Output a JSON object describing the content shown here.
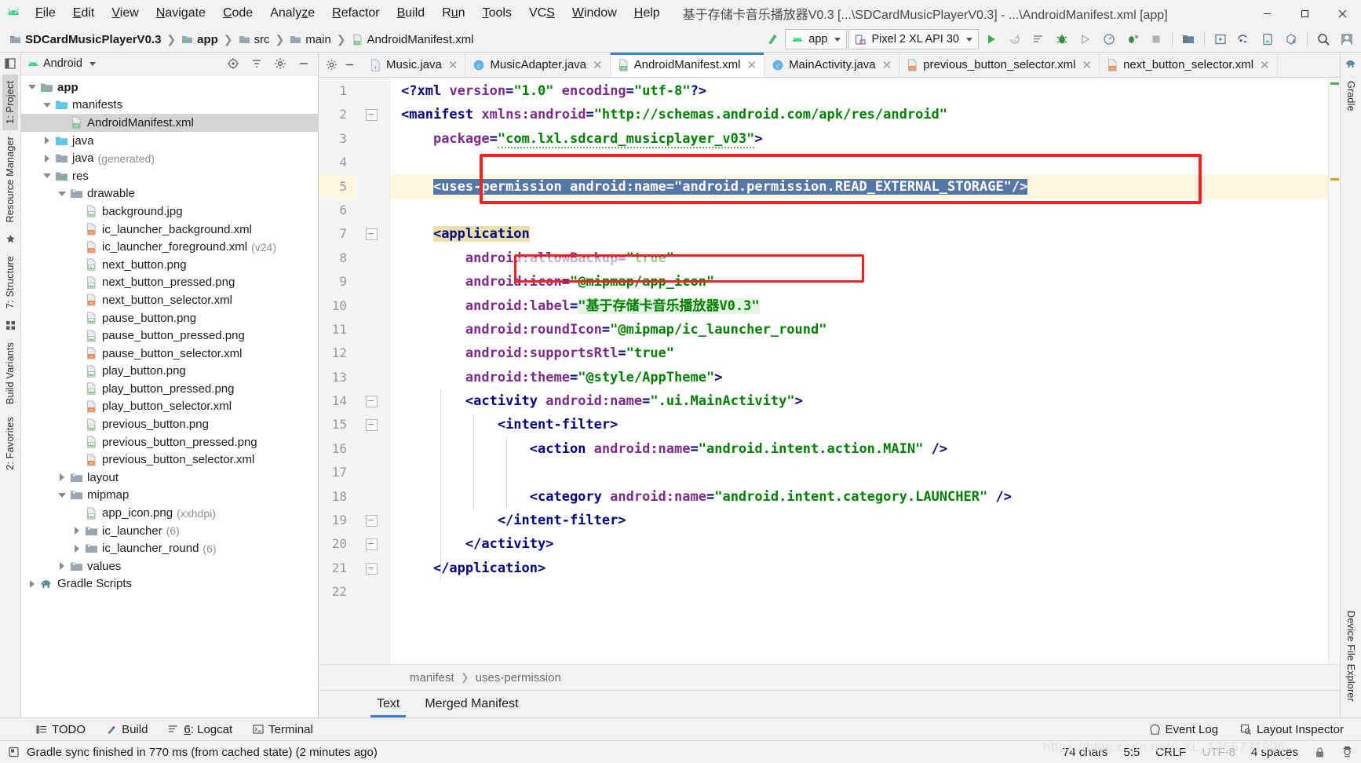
{
  "window": {
    "title": "基于存储卡音乐播放器V0.3 [...\\SDCardMusicPlayerV0.3] - ...\\AndroidManifest.xml [app]",
    "minimize": "–",
    "maximize": "□",
    "close": "✕"
  },
  "menubar": [
    {
      "label": "File",
      "mnemonic": "F"
    },
    {
      "label": "Edit",
      "mnemonic": "E"
    },
    {
      "label": "View",
      "mnemonic": "V"
    },
    {
      "label": "Navigate",
      "mnemonic": "N"
    },
    {
      "label": "Code",
      "mnemonic": "C"
    },
    {
      "label": "Analyze",
      "mnemonic": "z"
    },
    {
      "label": "Refactor",
      "mnemonic": "R"
    },
    {
      "label": "Build",
      "mnemonic": "B"
    },
    {
      "label": "Run",
      "mnemonic": "u"
    },
    {
      "label": "Tools",
      "mnemonic": "T"
    },
    {
      "label": "VCS",
      "mnemonic": "S"
    },
    {
      "label": "Window",
      "mnemonic": "W"
    },
    {
      "label": "Help",
      "mnemonic": "H"
    }
  ],
  "navbar": {
    "breadcrumbs": [
      "SDCardMusicPlayerV0.3",
      "app",
      "src",
      "main",
      "AndroidManifest.xml"
    ],
    "module_selector": "app",
    "device_selector": "Pixel 2 XL API 30"
  },
  "left_rail": [
    "1: Project",
    "Resource Manager",
    "7: Structure",
    "Build Variants",
    "2: Favorites"
  ],
  "right_rail": [
    "Gradle",
    "Device File Explorer"
  ],
  "project_panel": {
    "title": "Android",
    "tree": [
      {
        "depth": 0,
        "label": "app",
        "arrow": "down",
        "icon": "module-folder-icon",
        "bold": true
      },
      {
        "depth": 1,
        "label": "manifests",
        "arrow": "down",
        "icon": "folder-icon"
      },
      {
        "depth": 2,
        "label": "AndroidManifest.xml",
        "arrow": "none",
        "icon": "manifest-file-icon",
        "selected": true
      },
      {
        "depth": 1,
        "label": "java",
        "arrow": "right",
        "icon": "folder-icon"
      },
      {
        "depth": 1,
        "label": "java",
        "suffix": "(generated)",
        "arrow": "right",
        "icon": "generated-folder-icon"
      },
      {
        "depth": 1,
        "label": "res",
        "arrow": "down",
        "icon": "res-folder-icon"
      },
      {
        "depth": 2,
        "label": "drawable",
        "arrow": "down",
        "icon": "resource-folder-icon"
      },
      {
        "depth": 3,
        "label": "background.jpg",
        "arrow": "none",
        "icon": "image-file-icon"
      },
      {
        "depth": 3,
        "label": "ic_launcher_background.xml",
        "arrow": "none",
        "icon": "xml-file-icon"
      },
      {
        "depth": 3,
        "label": "ic_launcher_foreground.xml",
        "suffix": "(v24)",
        "arrow": "none",
        "icon": "xml-file-icon"
      },
      {
        "depth": 3,
        "label": "next_button.png",
        "arrow": "none",
        "icon": "image-file-icon"
      },
      {
        "depth": 3,
        "label": "next_button_pressed.png",
        "arrow": "none",
        "icon": "image-file-icon"
      },
      {
        "depth": 3,
        "label": "next_button_selector.xml",
        "arrow": "none",
        "icon": "xml-file-icon"
      },
      {
        "depth": 3,
        "label": "pause_button.png",
        "arrow": "none",
        "icon": "image-file-icon"
      },
      {
        "depth": 3,
        "label": "pause_button_pressed.png",
        "arrow": "none",
        "icon": "image-file-icon"
      },
      {
        "depth": 3,
        "label": "pause_button_selector.xml",
        "arrow": "none",
        "icon": "xml-file-icon"
      },
      {
        "depth": 3,
        "label": "play_button.png",
        "arrow": "none",
        "icon": "image-file-icon"
      },
      {
        "depth": 3,
        "label": "play_button_pressed.png",
        "arrow": "none",
        "icon": "image-file-icon"
      },
      {
        "depth": 3,
        "label": "play_button_selector.xml",
        "arrow": "none",
        "icon": "xml-file-icon"
      },
      {
        "depth": 3,
        "label": "previous_button.png",
        "arrow": "none",
        "icon": "image-file-icon"
      },
      {
        "depth": 3,
        "label": "previous_button_pressed.png",
        "arrow": "none",
        "icon": "image-file-icon"
      },
      {
        "depth": 3,
        "label": "previous_button_selector.xml",
        "arrow": "none",
        "icon": "xml-file-icon"
      },
      {
        "depth": 2,
        "label": "layout",
        "arrow": "right",
        "icon": "resource-folder-icon"
      },
      {
        "depth": 2,
        "label": "mipmap",
        "arrow": "down",
        "icon": "resource-folder-icon"
      },
      {
        "depth": 3,
        "label": "app_icon.png",
        "suffix": "(xxhdpi)",
        "arrow": "none",
        "icon": "image-file-icon"
      },
      {
        "depth": 3,
        "label": "ic_launcher",
        "suffix": "(6)",
        "arrow": "right",
        "icon": "resource-folder-icon"
      },
      {
        "depth": 3,
        "label": "ic_launcher_round",
        "suffix": "(6)",
        "arrow": "right",
        "icon": "resource-folder-icon"
      },
      {
        "depth": 2,
        "label": "values",
        "arrow": "right",
        "icon": "resource-folder-icon"
      },
      {
        "depth": 0,
        "label": "Gradle Scripts",
        "arrow": "right",
        "icon": "gradle-icon"
      }
    ]
  },
  "editor_tabs": [
    {
      "label": "Music.java",
      "icon": "java-file-icon",
      "active": false
    },
    {
      "label": "MusicAdapter.java",
      "icon": "class-file-icon",
      "active": false
    },
    {
      "label": "AndroidManifest.xml",
      "icon": "manifest-file-icon",
      "active": true
    },
    {
      "label": "MainActivity.java",
      "icon": "class-file-icon",
      "active": false
    },
    {
      "label": "previous_button_selector.xml",
      "icon": "xml-file-icon",
      "active": false
    },
    {
      "label": "next_button_selector.xml",
      "icon": "xml-file-icon",
      "active": false
    }
  ],
  "code": {
    "lines": [
      {
        "n": 1,
        "text": "<?xml version=\"1.0\" encoding=\"utf-8\"?>"
      },
      {
        "n": 2,
        "text": "<manifest xmlns:android=\"http://schemas.android.com/apk/res/android\""
      },
      {
        "n": 3,
        "text": "    package=\"com.lxl.sdcard_musicplayer_v03\">"
      },
      {
        "n": 4,
        "text": ""
      },
      {
        "n": 5,
        "text": "    <uses-permission android:name=\"android.permission.READ_EXTERNAL_STORAGE\"/>"
      },
      {
        "n": 6,
        "text": ""
      },
      {
        "n": 7,
        "text": "    <application"
      },
      {
        "n": 8,
        "text": "        android:allowBackup=\"true\""
      },
      {
        "n": 9,
        "text": "        android:icon=\"@mipmap/app_icon\""
      },
      {
        "n": 10,
        "text": "        android:label=\"基于存储卡音乐播放器V0.3\""
      },
      {
        "n": 11,
        "text": "        android:roundIcon=\"@mipmap/ic_launcher_round\""
      },
      {
        "n": 12,
        "text": "        android:supportsRtl=\"true\""
      },
      {
        "n": 13,
        "text": "        android:theme=\"@style/AppTheme\">"
      },
      {
        "n": 14,
        "text": "        <activity android:name=\".ui.MainActivity\">"
      },
      {
        "n": 15,
        "text": "            <intent-filter>"
      },
      {
        "n": 16,
        "text": "                <action android:name=\"android.intent.action.MAIN\" />"
      },
      {
        "n": 17,
        "text": ""
      },
      {
        "n": 18,
        "text": "                <category android:name=\"android.intent.category.LAUNCHER\" />"
      },
      {
        "n": 19,
        "text": "            </intent-filter>"
      },
      {
        "n": 20,
        "text": "        </activity>"
      },
      {
        "n": 21,
        "text": "    </application>"
      },
      {
        "n": 22,
        "text": ""
      }
    ],
    "caret_line": 5,
    "annotations": [
      {
        "name": "uses-permission-highlight-box",
        "line": 5,
        "color": "#f5211f"
      },
      {
        "name": "android-icon-highlight-box",
        "line": 9,
        "color": "#f5211f"
      }
    ]
  },
  "code_breadcrumb": [
    "manifest",
    "uses-permission"
  ],
  "editor_subtabs": [
    {
      "label": "Text",
      "active": true
    },
    {
      "label": "Merged Manifest",
      "active": false
    }
  ],
  "bottom_toolwindows": [
    {
      "label": "TODO",
      "icon": "todo-icon",
      "mnemonic": ""
    },
    {
      "label": "Build",
      "icon": "build-icon",
      "mnemonic": ""
    },
    {
      "label": "6: Logcat",
      "icon": "logcat-icon",
      "mnemonic": "6"
    },
    {
      "label": "Terminal",
      "icon": "terminal-icon",
      "mnemonic": ""
    }
  ],
  "bottom_right": [
    {
      "label": "Event Log",
      "icon": "event-log-icon"
    },
    {
      "label": "Layout Inspector",
      "icon": "layout-inspector-icon"
    }
  ],
  "statusbar": {
    "message": "Gradle sync finished in 770 ms (from cached state) (2 minutes ago)",
    "chars": "74 chars",
    "caret_position": "5:5",
    "line_separator": "CRLF",
    "encoding": "UTF-8",
    "indent": "4 spaces"
  },
  "watermark": "https://blog.csdn.net/LXL_1355771905",
  "colors": {
    "accent": "#3c7fd0",
    "highlight_box": "#f5211f",
    "selection": "#5577a8",
    "tag": "#000080",
    "attribute": "#7d2b8b",
    "string": "#008000",
    "caret_line": "#fdf6dd"
  }
}
